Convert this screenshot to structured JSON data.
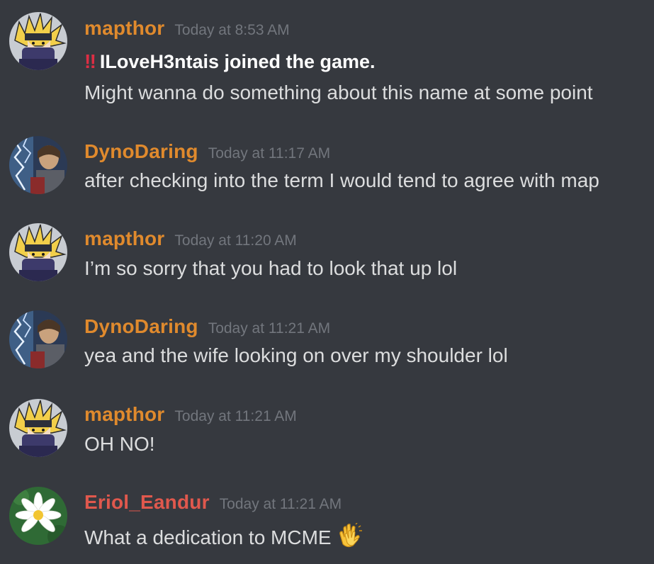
{
  "colors": {
    "background": "#36393f",
    "username_orange": "#e08a2d",
    "username_red": "#e0584d",
    "timestamp": "#72767d",
    "message_text": "#dcddde",
    "alert_red": "#dd2e44"
  },
  "messages": [
    {
      "username": "mapthor",
      "timestamp": "Today at 8:53 AM",
      "avatar_icon": "spiky-hair-avatar-icon",
      "alert_prefix": "‼",
      "lines": [
        "ILoveH3ntais joined the game.",
        "Might wanna do something about this name at some point"
      ]
    },
    {
      "username": "DynoDaring",
      "timestamp": "Today at 11:17 AM",
      "avatar_icon": "lightning-avatar-icon",
      "lines": [
        "after checking into the term I would tend to agree with map"
      ]
    },
    {
      "username": "mapthor",
      "timestamp": "Today at 11:20 AM",
      "avatar_icon": "spiky-hair-avatar-icon",
      "lines": [
        "I’m so sorry that you had to look that up lol"
      ]
    },
    {
      "username": "DynoDaring",
      "timestamp": "Today at 11:21 AM",
      "avatar_icon": "lightning-avatar-icon",
      "lines": [
        "yea and the wife looking on over my shoulder lol"
      ]
    },
    {
      "username": "mapthor",
      "timestamp": "Today at 11:21 AM",
      "avatar_icon": "spiky-hair-avatar-icon",
      "lines": [
        "OH NO!"
      ]
    },
    {
      "username": "Eriol_Eandur",
      "timestamp": "Today at 11:21 AM",
      "avatar_icon": "water-lily-avatar-icon",
      "lines": [
        "What a dedication to MCME"
      ],
      "trailing_emoji": "clapping-hands-icon"
    }
  ]
}
